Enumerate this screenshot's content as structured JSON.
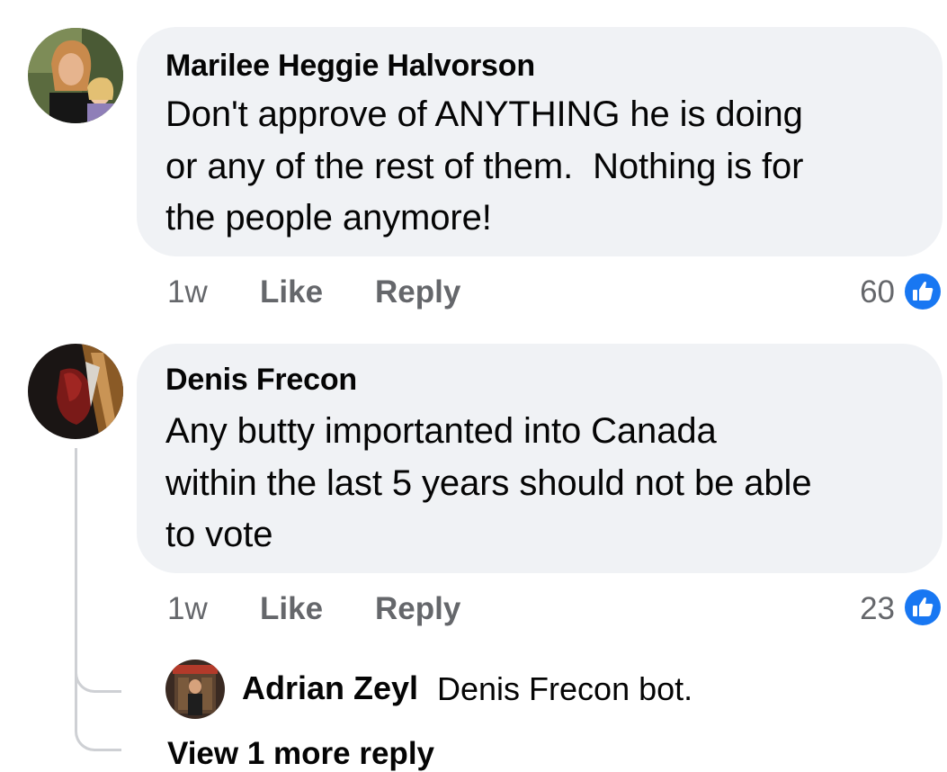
{
  "comments": [
    {
      "author": "Marilee Heggie Halvorson",
      "text_lines": [
        "Don't approve of ANYTHING he is doing",
        "or any of the rest of them.  Nothing is for",
        "the people anymore!"
      ],
      "time": "1w",
      "like_label": "Like",
      "reply_label": "Reply",
      "reaction_count": "60",
      "reaction_icon": "like-icon"
    },
    {
      "author": "Denis Frecon",
      "text_lines": [
        "Any butty importanted into Canada",
        "within the last 5 years should not be able",
        "to vote"
      ],
      "time": "1w",
      "like_label": "Like",
      "reply_label": "Reply",
      "reaction_count": "23",
      "reaction_icon": "like-icon"
    }
  ],
  "reply": {
    "author": "Adrian Zeyl",
    "text": "Denis Frecon bot."
  },
  "view_more_replies": "View 1 more reply",
  "colors": {
    "bubble": "#f0f2f5",
    "meta_text": "#65676b",
    "like_blue": "#1877f2",
    "thread_line": "#ced0d4"
  }
}
